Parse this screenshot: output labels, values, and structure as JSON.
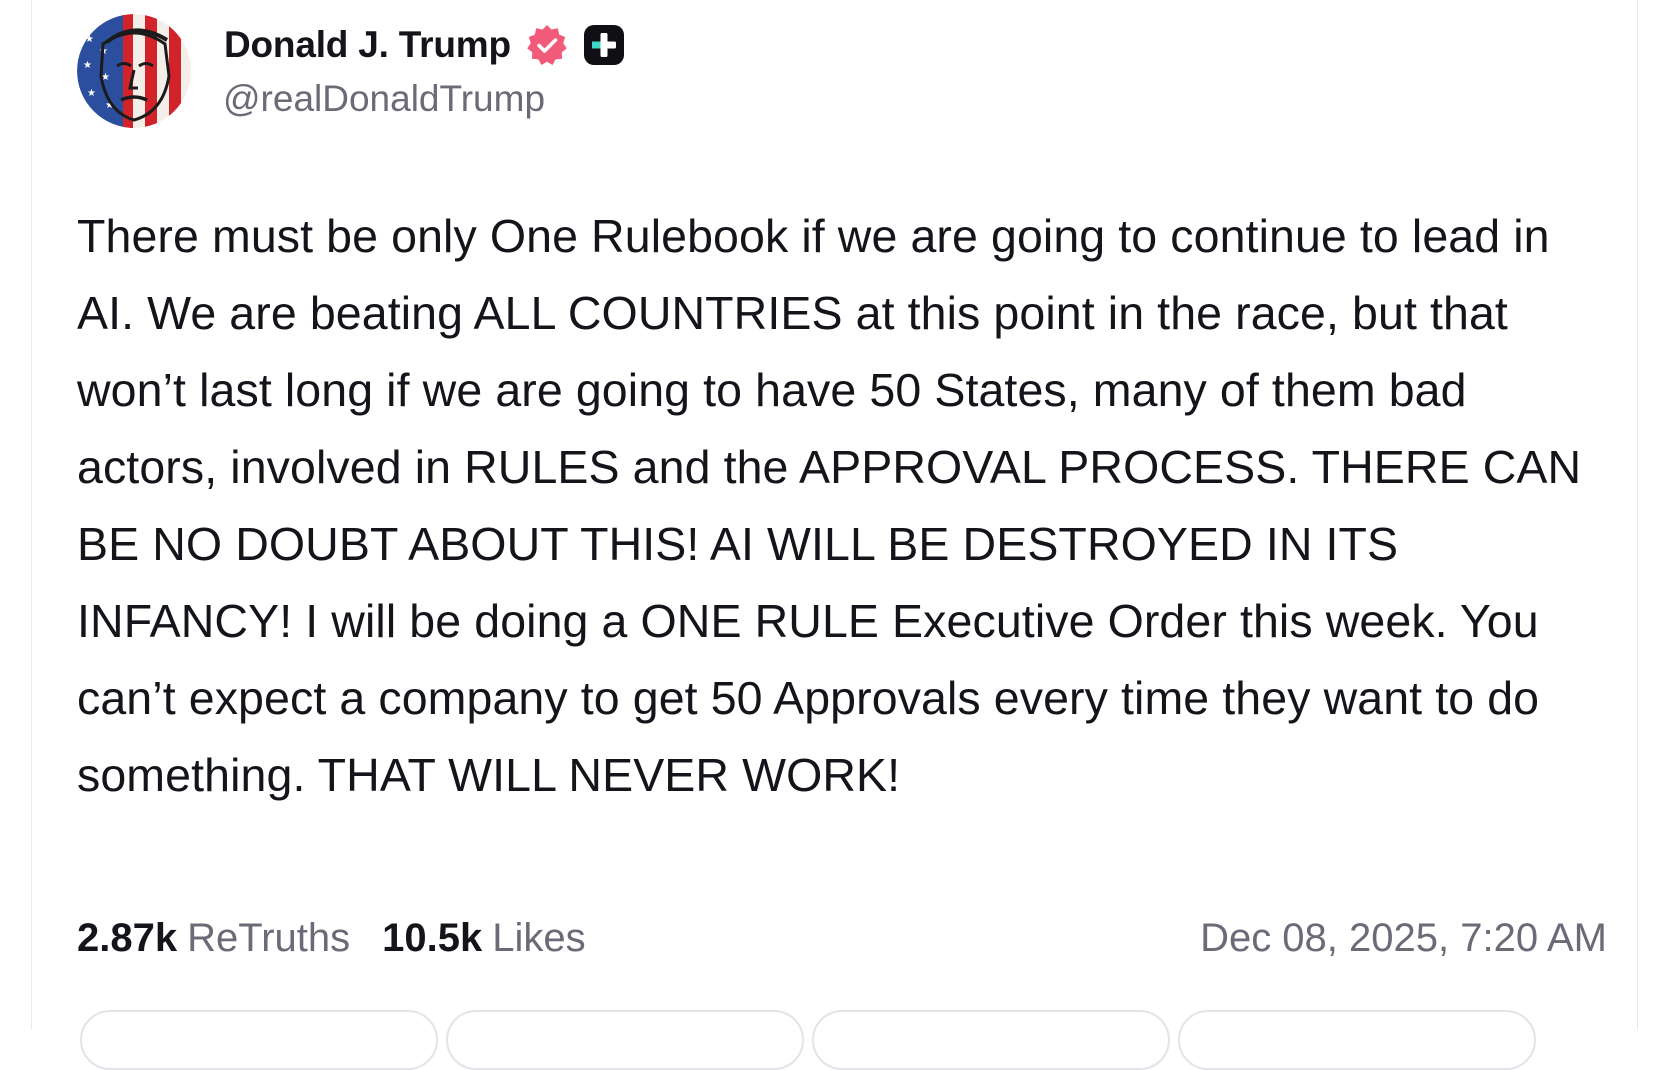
{
  "post": {
    "author": {
      "display_name": "Donald J. Trump",
      "handle": "@realDonaldTrump",
      "verified_icon": "verified-badge-icon",
      "plus_icon": "plus-badge-icon",
      "verified_color": "#f25a7a"
    },
    "body": "There must be only One Rulebook if we are going to continue to lead in AI. We are beating ALL COUNTRIES at this point in the race, but that won’t last long if we are going to have 50 States, many of them bad actors, involved in RULES and the APPROVAL PROCESS. THERE CAN BE NO DOUBT ABOUT THIS! AI WILL BE DESTROYED IN ITS INFANCY! I will be doing a ONE RULE Executive Order this week. You can’t expect a company to get 50 Approvals every time they want to do something. THAT WILL NEVER WORK!",
    "stats": {
      "retruths_count": "2.87k",
      "retruths_label": "ReTruths",
      "likes_count": "10.5k",
      "likes_label": "Likes"
    },
    "timestamp": "Dec 08, 2025, 7:20 AM"
  }
}
